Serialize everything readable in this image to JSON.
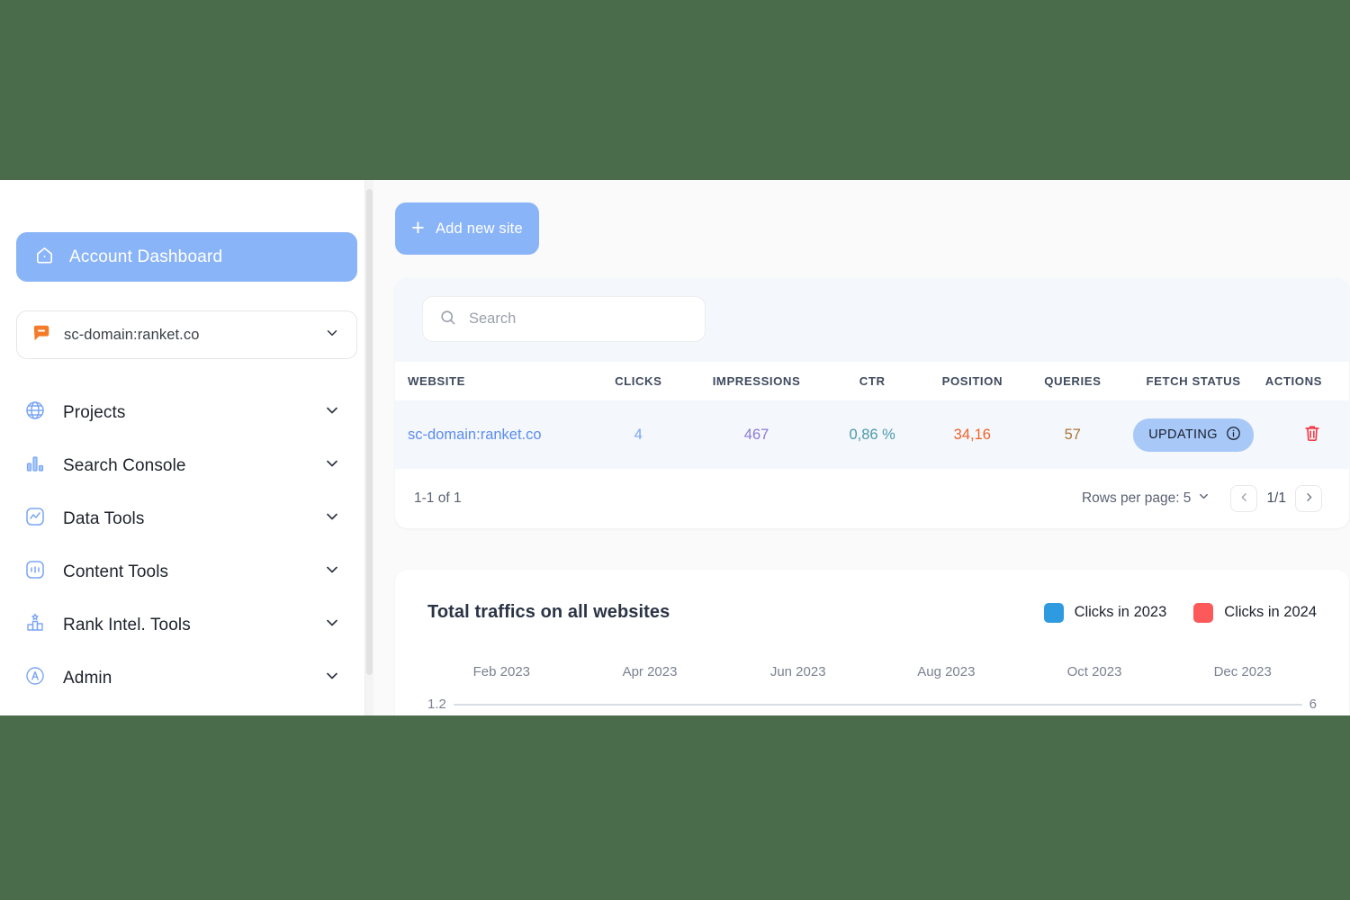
{
  "theme": {
    "outer_bg": "#4a6c4a",
    "content_bg": "#fafafa",
    "accent_blue": "#8ab4f8",
    "card_tint": "#f4f7fc"
  },
  "sidebar": {
    "dashboard": {
      "label": "Account Dashboard",
      "icon": "home-icon"
    },
    "domain_selector": {
      "value": "sc-domain:ranket.co",
      "icon": "chat-bubble-icon",
      "chevron": "chevron-down-icon"
    },
    "items": [
      {
        "label": "Projects",
        "icon": "globe-icon"
      },
      {
        "label": "Search Console",
        "icon": "bar-chart-icon"
      },
      {
        "label": "Data Tools",
        "icon": "activity-square-icon"
      },
      {
        "label": "Content Tools",
        "icon": "content-square-icon"
      },
      {
        "label": "Rank Intel. Tools",
        "icon": "podium-icon"
      },
      {
        "label": "Admin",
        "icon": "admin-circle-icon"
      }
    ]
  },
  "toolbar": {
    "add_site_label": "Add new site",
    "add_icon": "plus-icon"
  },
  "search": {
    "placeholder": "Search",
    "value": "",
    "icon": "search-icon"
  },
  "table": {
    "columns": [
      "WEBSITE",
      "CLICKS",
      "IMPRESSIONS",
      "CTR",
      "POSITION",
      "QUERIES",
      "FETCH STATUS",
      "ACTIONS"
    ],
    "rows": [
      {
        "website": "sc-domain:ranket.co",
        "clicks": "4",
        "impressions": "467",
        "ctr": "0,86 %",
        "position": "34,16",
        "queries": "57",
        "fetch_status": "UPDATING",
        "status_info_icon": "info-icon",
        "delete_icon": "trash-icon"
      }
    ]
  },
  "footer": {
    "count": "1-1 of 1",
    "rows_per_page_label": "Rows per page: 5",
    "rows_per_page_chevron": "chevron-down-icon",
    "prev_icon": "chevron-left-icon",
    "page_label": "1/1",
    "next_icon": "chevron-right-icon"
  },
  "chart_data": {
    "type": "line",
    "title": "Total traffics on all websites",
    "xlabel": "",
    "ylabel": "",
    "grid": false,
    "legend_position": "top-right",
    "categories": [
      "Feb 2023",
      "Apr 2023",
      "Jun 2023",
      "Aug 2023",
      "Oct 2023",
      "Dec 2023"
    ],
    "tick_labels": [
      "Feb 2023",
      "Apr 2023",
      "Jun 2023",
      "Aug 2023",
      "Oct 2023",
      "Dec 2023"
    ],
    "axis_start_label": "1.2",
    "axis_end_label": "6",
    "series": [
      {
        "name": "Clicks in 2023",
        "color": "#2e9be0",
        "values": []
      },
      {
        "name": "Clicks in 2024",
        "color": "#fc5a5a",
        "values": []
      }
    ]
  }
}
